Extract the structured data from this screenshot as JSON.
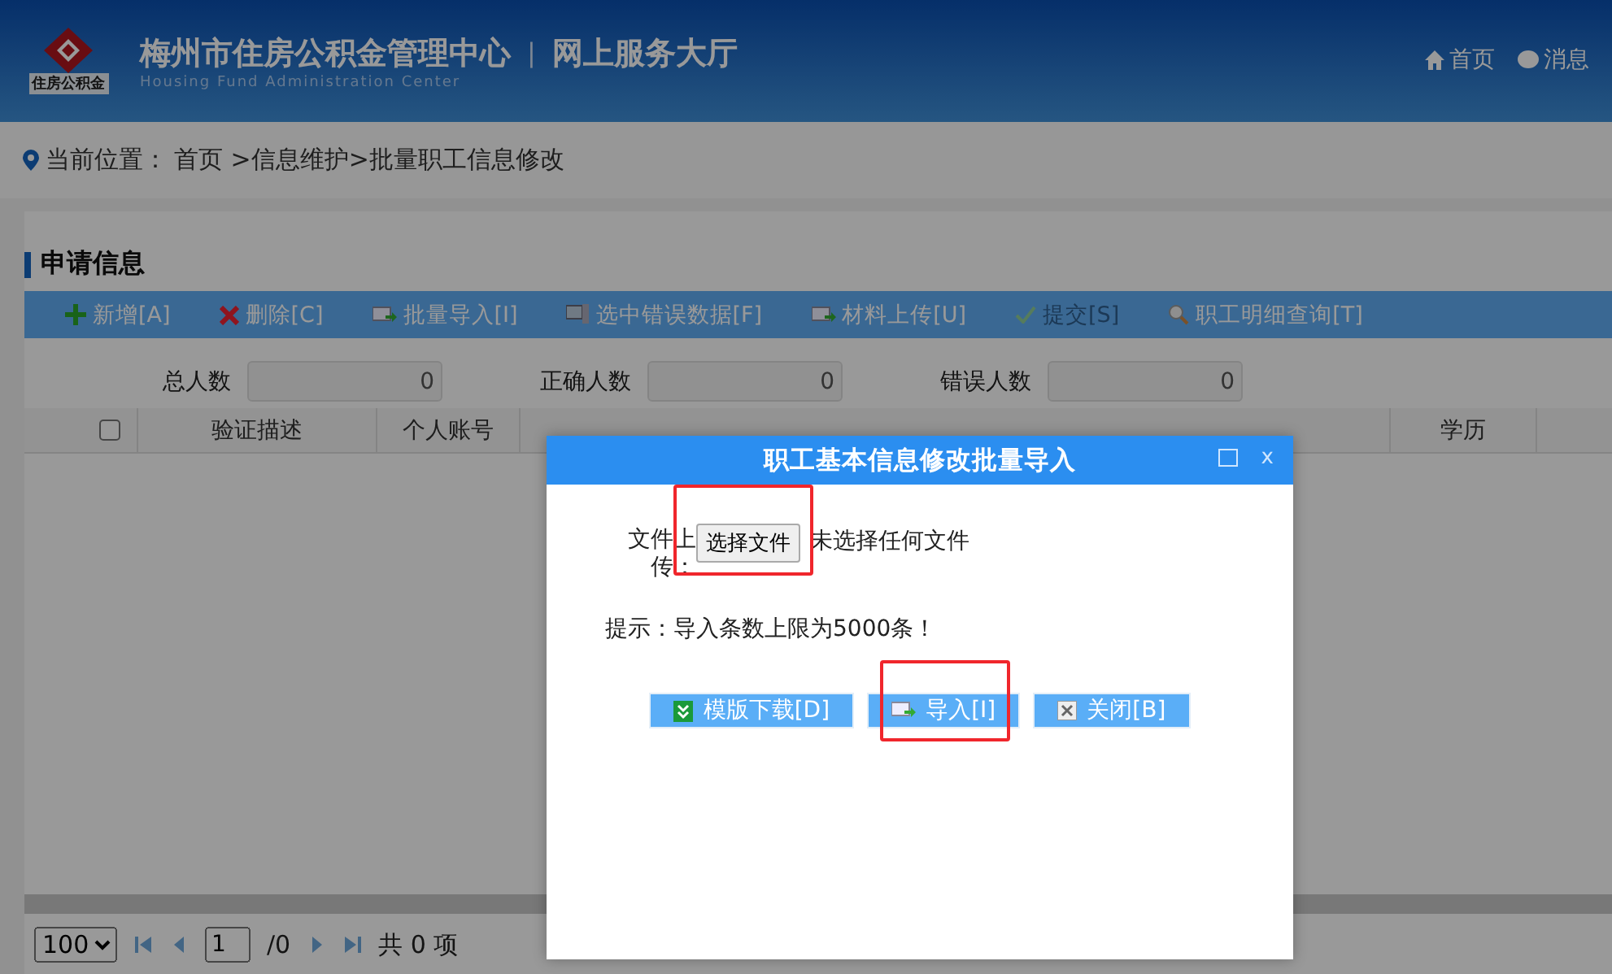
{
  "header": {
    "org_name": "梅州市住房公积金管理中心",
    "divider": "|",
    "portal_name": "网上服务大厅",
    "subtitle": "Housing Fund Administration Center",
    "logo_text": "住房公积金",
    "nav": [
      {
        "kind": "home",
        "label": "首页"
      },
      {
        "kind": "message",
        "label": "消息"
      }
    ]
  },
  "breadcrumb": {
    "label": "当前位置：",
    "path": "首页 >信息维护>批量职工信息修改"
  },
  "section_title": "申请信息",
  "toolbar": [
    {
      "kind": "add",
      "label": "新增[A]",
      "disabled": false
    },
    {
      "kind": "delete",
      "label": "删除[C]",
      "disabled": false
    },
    {
      "kind": "import",
      "label": "批量导入[I]",
      "disabled": false
    },
    {
      "kind": "computer",
      "label": "选中错误数据[F]",
      "disabled": false
    },
    {
      "kind": "import",
      "label": "材料上传[U]",
      "disabled": false
    },
    {
      "kind": "check",
      "label": "提交[S]",
      "disabled": true
    },
    {
      "kind": "search",
      "label": "职工明细查询[T]",
      "disabled": false
    }
  ],
  "counts": [
    {
      "label": "总人数",
      "value": "0"
    },
    {
      "label": "正确人数",
      "value": "0"
    },
    {
      "label": "错误人数",
      "value": "0"
    }
  ],
  "table": {
    "select_all": {
      "checked": false
    },
    "columns": [
      "验证描述",
      "个人账号",
      "学历"
    ]
  },
  "pager": {
    "page_size": "100",
    "page": "1",
    "total_pages": "/0",
    "total": "共 0 项"
  },
  "dialog": {
    "title": "职工基本信息修改批量导入",
    "file_label": "文件上传：",
    "file_button": "选择文件",
    "file_status": "未选择任何文件",
    "hint": "提示：导入条数上限为5000条！",
    "buttons": [
      {
        "kind": "download",
        "label": "模版下载[D]",
        "highlighted": false
      },
      {
        "kind": "import",
        "label": "导入[I]",
        "highlighted": true
      },
      {
        "kind": "close",
        "label": "关闭[B]",
        "highlighted": false
      }
    ],
    "file_button_highlighted": true,
    "close_glyph": "x"
  }
}
